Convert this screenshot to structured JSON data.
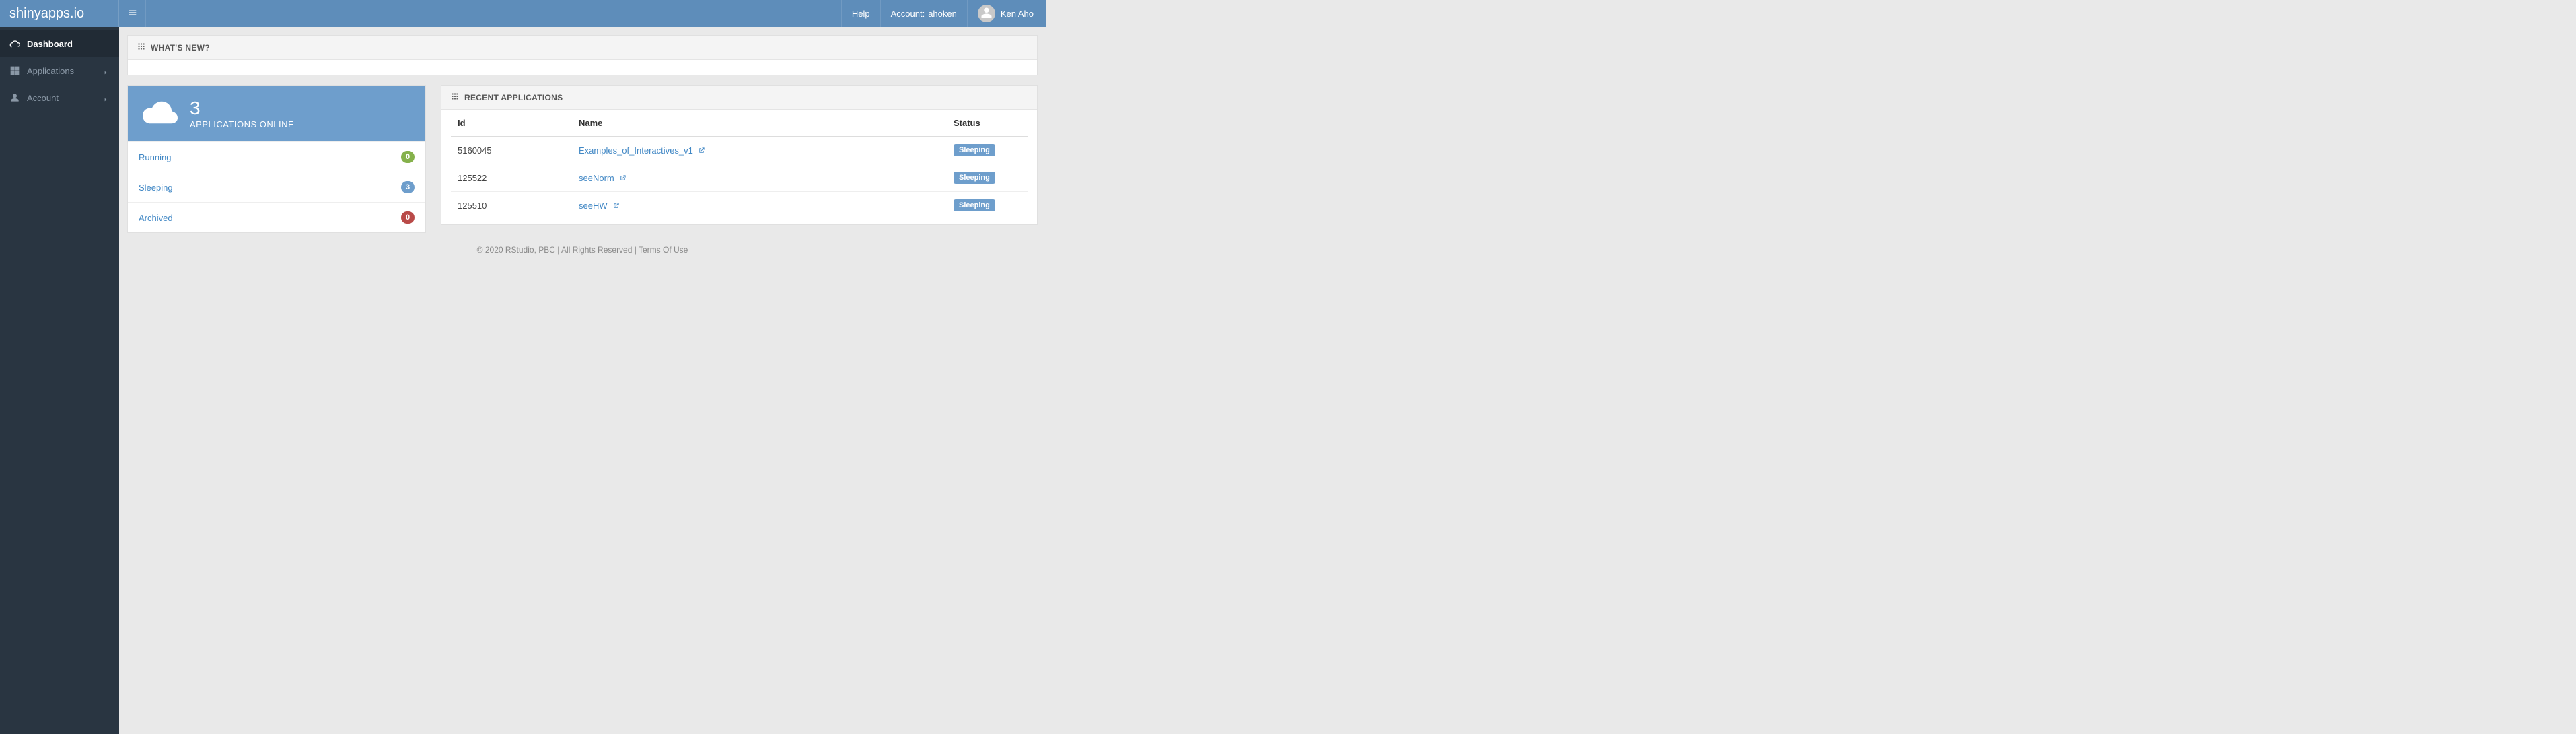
{
  "brand": "shinyapps.io",
  "header": {
    "help": "Help",
    "account_label": "Account:",
    "account_name": "ahoken",
    "user_name": "Ken Aho"
  },
  "sidebar": {
    "items": [
      {
        "label": "Dashboard",
        "icon": "cloud",
        "active": true,
        "expandable": false
      },
      {
        "label": "Applications",
        "icon": "grid",
        "active": false,
        "expandable": true
      },
      {
        "label": "Account",
        "icon": "person",
        "active": false,
        "expandable": true
      }
    ]
  },
  "whatsnew": {
    "title": "WHAT'S NEW?"
  },
  "summary": {
    "count": "3",
    "subtitle": "APPLICATIONS ONLINE",
    "rows": [
      {
        "label": "Running",
        "count": "0",
        "color": "green"
      },
      {
        "label": "Sleeping",
        "count": "3",
        "color": "blue"
      },
      {
        "label": "Archived",
        "count": "0",
        "color": "red"
      }
    ]
  },
  "recent": {
    "title": "RECENT APPLICATIONS",
    "columns": {
      "id": "Id",
      "name": "Name",
      "status": "Status"
    },
    "rows": [
      {
        "id": "5160045",
        "name": "Examples_of_Interactives_v1",
        "status": "Sleeping"
      },
      {
        "id": "125522",
        "name": "seeNorm",
        "status": "Sleeping"
      },
      {
        "id": "125510",
        "name": "seeHW",
        "status": "Sleeping"
      }
    ]
  },
  "footer": {
    "copyright": "© 2020 RStudio, PBC | All Rights Reserved | ",
    "terms": "Terms Of Use"
  }
}
